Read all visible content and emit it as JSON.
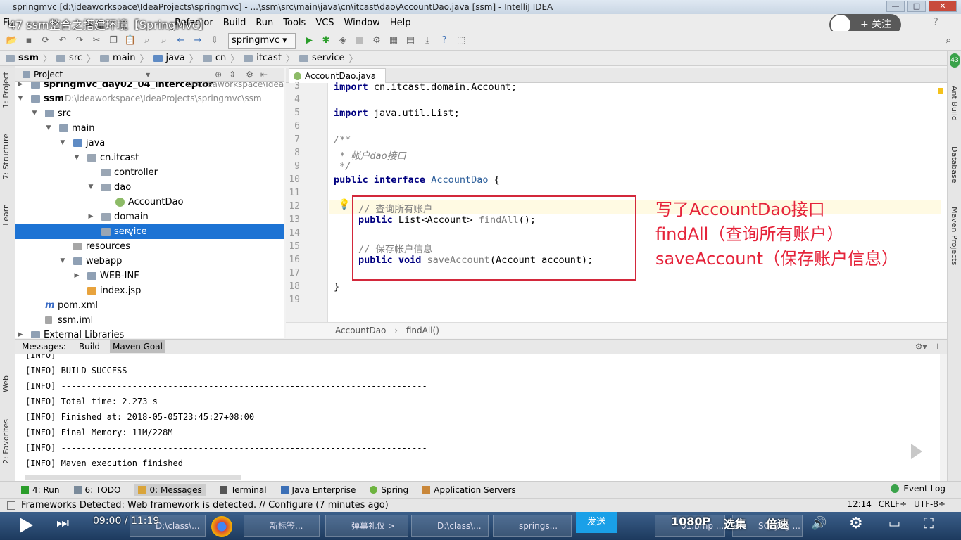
{
  "window": {
    "title": "springmvc [d:\\ideaworkspace\\IdeaProjects\\springmvc] - ...\\ssm\\src\\main\\java\\cn\\itcast\\dao\\AccountDao.java [ssm] - IntelliJ IDEA"
  },
  "video": {
    "title": "47 ssm整合之搭建环境【SpringMvc】",
    "follow_label": "+ 关注",
    "time": "09:00 / 11:19",
    "send": "发送",
    "quality": "1080P",
    "episodes": "选集",
    "speed": "倍速"
  },
  "menu": [
    "File",
    "Edit",
    "View",
    "Navigate",
    "Code",
    "Analyze",
    "Refactor",
    "Build",
    "Run",
    "Tools",
    "VCS",
    "Window",
    "Help"
  ],
  "menu_visible": [
    "Fi",
    "Refactor",
    "Build",
    "Run",
    "Tools",
    "VCS",
    "Window",
    "Help"
  ],
  "toolbar": {
    "run_config": "springmvc"
  },
  "nav": [
    "ssm",
    "src",
    "main",
    "java",
    "cn",
    "itcast",
    "service"
  ],
  "left_tabs": [
    "1: Project",
    "7: Structure",
    "Learn",
    "Web",
    "2: Favorites"
  ],
  "right_tabs": [
    "Ant Build",
    "Database",
    "Maven Projects"
  ],
  "project": {
    "header": "Project",
    "rows": [
      {
        "label": "springmvc_day02_04_interceptor",
        "extra": "D:\\ideaworkspace\\IdeaProjects\\idea"
      },
      {
        "label": "ssm",
        "extra": "D:\\ideaworkspace\\IdeaProjects\\springmvc\\ssm"
      },
      {
        "label": "src"
      },
      {
        "label": "main"
      },
      {
        "label": "java"
      },
      {
        "label": "cn.itcast"
      },
      {
        "label": "controller"
      },
      {
        "label": "dao"
      },
      {
        "label": "AccountDao"
      },
      {
        "label": "domain"
      },
      {
        "label": "service"
      },
      {
        "label": "resources"
      },
      {
        "label": "webapp"
      },
      {
        "label": "WEB-INF"
      },
      {
        "label": "index.jsp"
      },
      {
        "label": "pom.xml"
      },
      {
        "label": "ssm.iml"
      },
      {
        "label": "External Libraries"
      }
    ]
  },
  "editor": {
    "tab": "AccountDao.java",
    "line_numbers": [
      "3",
      "4",
      "5",
      "6",
      "7",
      "8",
      "9",
      "10",
      "11",
      "12",
      "13",
      "14",
      "15",
      "16",
      "17",
      "18",
      "19"
    ],
    "breadcrumb": [
      "AccountDao",
      "findAll()"
    ],
    "annotation": [
      "写了AccountDao接口",
      "findAll（查询所有账户）",
      "saveAccount（保存账户信息）"
    ]
  },
  "bottom_tabs": [
    "Messages:",
    "Build",
    "Maven Goal"
  ],
  "console": [
    "[INFO]",
    "[INFO] BUILD SUCCESS",
    "[INFO] ------------------------------------------------------------------------",
    "[INFO] Total time: 2.273 s",
    "[INFO] Finished at: 2018-05-05T23:45:27+08:00",
    "[INFO] Final Memory: 11M/228M",
    "[INFO] ------------------------------------------------------------------------",
    "[INFO] Maven execution finished"
  ],
  "tool_windows": [
    "4: Run",
    "6: TODO",
    "0: Messages",
    "Terminal",
    "Java Enterprise",
    "Spring",
    "Application Servers"
  ],
  "event_log": "Event Log",
  "status": {
    "message": "Frameworks Detected: Web framework is detected. // Configure (7 minutes ago)",
    "position": "12:14",
    "line_sep": "CRLF÷",
    "encoding": "UTF-8÷"
  },
  "taskbar": [
    "D:\\class\\...",
    "新标签...",
    "弹幕礼仪 >",
    "D:\\class\\...",
    "springs...",
    "01.bmp ...",
    "SQLyog ..."
  ]
}
